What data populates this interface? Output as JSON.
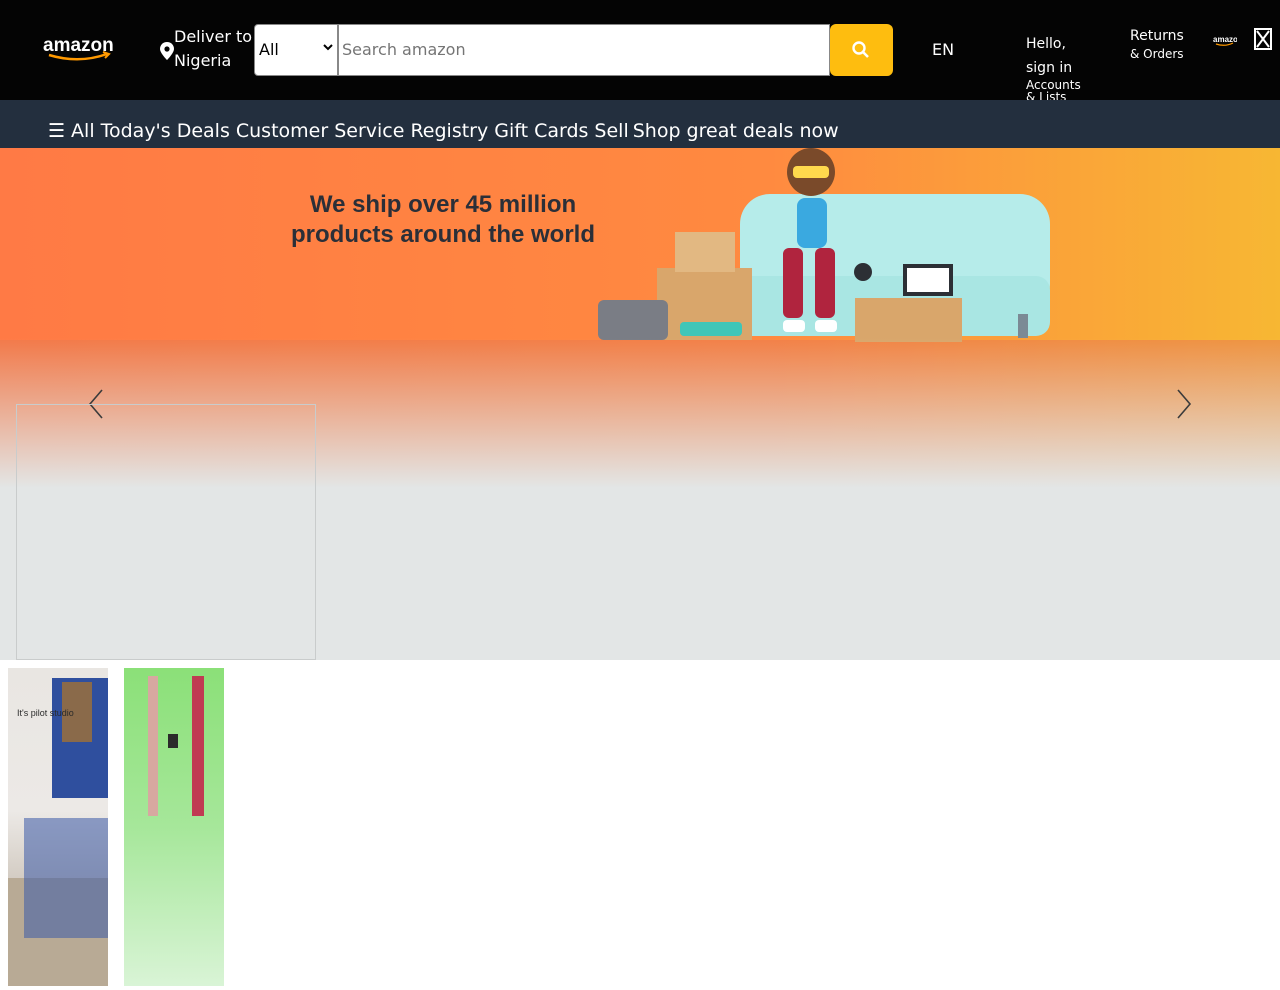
{
  "header": {
    "logo_text": "amazon",
    "deliver_line1": "Deliver to",
    "deliver_line2": "Nigeria",
    "search_category": "All",
    "search_placeholder": "Search amazon",
    "language": "EN",
    "account_line1": "Hello,",
    "account_line2": "sign in",
    "account_line3": "Accounts",
    "account_line4": "& Lists",
    "returns_line1": "Returns",
    "returns_line2": "& Orders",
    "mini_logo_text": "amazon",
    "icons": [
      "location-pin-icon",
      "search-icon",
      "cart-icon",
      "chevron-down-icon"
    ]
  },
  "subnav": {
    "items": [
      "All",
      "Today's Deals",
      "Customer Service",
      "Registry",
      "Gift Cards",
      "Sell"
    ],
    "promo": "Shop great deals now",
    "icons": [
      "menu-icon"
    ]
  },
  "hero": {
    "headline_line1": "We ship over 45 million",
    "headline_line2": "products around the world",
    "icons": [
      "chevron-left-icon",
      "chevron-right-icon"
    ],
    "colors": {
      "banner_start": "#ff7a45",
      "banner_end": "#f7b733",
      "background": "#e3e6e6"
    }
  },
  "tiles": [
    {
      "name": "home-decor-tile",
      "text": "It's pilot studio"
    },
    {
      "name": "green-product-tile",
      "text": ""
    }
  ],
  "colors": {
    "nav": "#040404",
    "subnav": "#232f3e",
    "accent": "#febd0f"
  }
}
